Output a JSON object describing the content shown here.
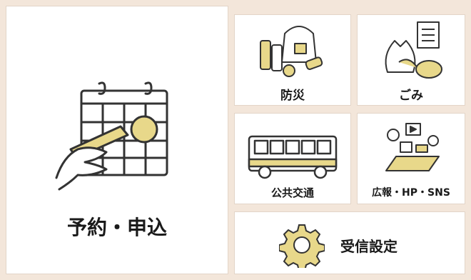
{
  "tiles": {
    "reservation": {
      "label": "予約・申込",
      "icon": "calendar-hand-icon"
    },
    "disaster": {
      "label": "防災",
      "icon": "emergency-supplies-icon"
    },
    "garbage": {
      "label": "ごみ",
      "icon": "garbage-bag-icon"
    },
    "transport": {
      "label": "公共交通",
      "icon": "bus-icon"
    },
    "pr": {
      "label": "広報・HP・SNS",
      "icon": "tablet-media-icon"
    },
    "settings": {
      "label": "受信設定",
      "icon": "gear-icon"
    }
  },
  "colors": {
    "accent": "#e8d88a",
    "background": "#f3e6da",
    "outline": "#333333"
  }
}
